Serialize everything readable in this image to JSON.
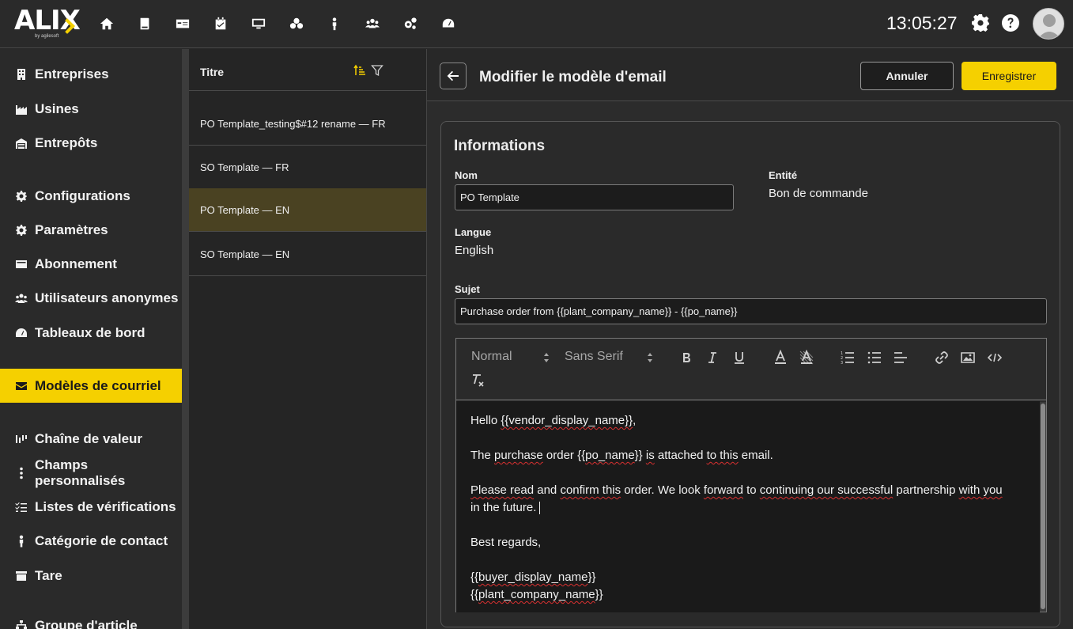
{
  "topbar": {
    "logo_text": "ALIX",
    "logo_sub": "by agilesoft",
    "clock": "13:05:27",
    "nav_icons": [
      "home-icon",
      "book-icon",
      "card-icon",
      "calendar-check-icon",
      "monitor-icon",
      "boxes-icon",
      "person-icon",
      "users-icon",
      "cogs-icon",
      "gauge-icon"
    ]
  },
  "sidebar": {
    "items": [
      {
        "label": "Entreprises",
        "icon": "building-icon"
      },
      {
        "label": "Usines",
        "icon": "factory-icon"
      },
      {
        "label": "Entrepôts",
        "icon": "warehouse-icon"
      },
      {
        "label": "Configurations",
        "icon": "gear-icon"
      },
      {
        "label": "Paramètres",
        "icon": "gear-icon"
      },
      {
        "label": "Abonnement",
        "icon": "credit-card-icon"
      },
      {
        "label": "Utilisateurs anonymes",
        "icon": "users-icon"
      },
      {
        "label": "Tableaux de bord",
        "icon": "gauge-icon"
      },
      {
        "label": "Modèles de courriel",
        "icon": "envelope-icon",
        "active": true
      },
      {
        "label": "Chaîne de valeur",
        "icon": "chart-bars-icon"
      },
      {
        "label": "Champs personnalisés",
        "icon": "ellipsis-vertical-icon"
      },
      {
        "label": "Listes de vérifications",
        "icon": "checklist-icon"
      },
      {
        "label": "Catégorie de contact",
        "icon": "person-icon"
      },
      {
        "label": "Tare",
        "icon": "archive-icon"
      },
      {
        "label": "Groupe d'article",
        "icon": "sitemap-icon"
      }
    ]
  },
  "list": {
    "header": "Titre",
    "rows": [
      {
        "label": "PO Template_testing$#12 rename — FR"
      },
      {
        "label": "SO Template — FR"
      },
      {
        "label": "PO Template — EN",
        "selected": true
      },
      {
        "label": "SO Template — EN"
      }
    ]
  },
  "main": {
    "title": "Modifier le modèle d'email",
    "cancel_label": "Annuler",
    "save_label": "Enregistrer",
    "colors": {
      "accent": "#f5d000",
      "selected_row": "#4a4222"
    },
    "card": {
      "title": "Informations",
      "name_label": "Nom",
      "name_value": "PO Template",
      "entity_label": "Entité",
      "entity_value": "Bon de commande",
      "language_label": "Langue",
      "language_value": "English",
      "subject_label": "Sujet",
      "subject_value": "Purchase order from {{plant_company_name}} - {{po_name}}"
    },
    "editor": {
      "format_select": "Normal",
      "font_select": "Sans Serif",
      "tools": [
        "bold-icon",
        "italic-icon",
        "underline-icon",
        "text-color-icon",
        "background-color-icon",
        "ordered-list-icon",
        "bullet-list-icon",
        "align-icon",
        "link-icon",
        "image-icon",
        "code-icon",
        "clear-format-icon"
      ],
      "body": {
        "line1a": "Hello ",
        "line1b": "{{vendor_display_name}}",
        "line1c": ",",
        "line2a": "The ",
        "line2b": "purchase",
        "line2c": " order {{",
        "line2d": "po_name",
        "line2e": "}} ",
        "line2f": "is",
        "line2g": " attached ",
        "line2h": "to this",
        "line2i": " email.",
        "line3a": "Please read",
        "line3b": " and ",
        "line3c": "confirm this",
        "line3d": " order. We look ",
        "line3e": "forward",
        "line3f": " to ",
        "line3g": "continuing our successful",
        "line3h": " partnership ",
        "line3i": "with you",
        "line3j": "in the future.",
        "line4": "Best regards,",
        "line5a": "{{",
        "line5b": "buyer_display_name",
        "line5c": "}}",
        "line6a": "{{",
        "line6b": "plant_company_name",
        "line6c": "}}"
      }
    }
  }
}
